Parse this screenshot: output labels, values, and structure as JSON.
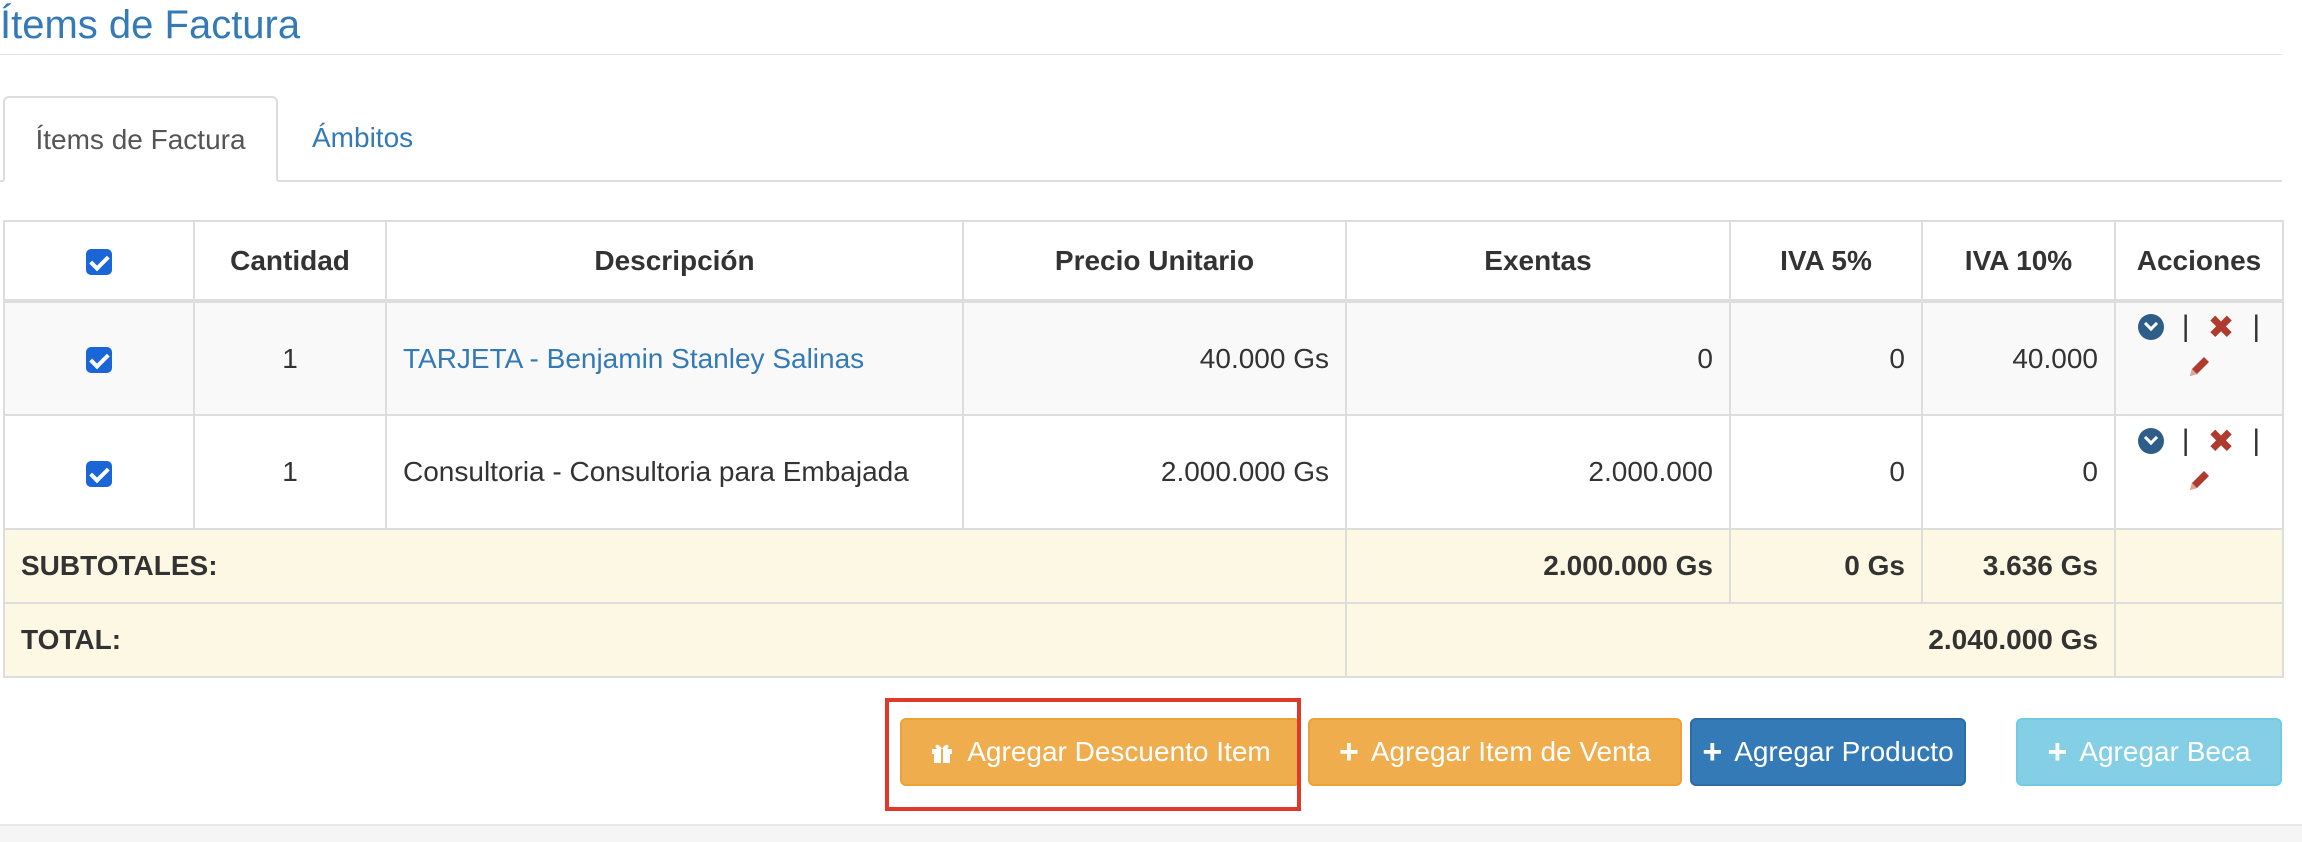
{
  "page_title": "Ítems de Factura",
  "tabs": [
    {
      "label": "Ítems de Factura",
      "active": true
    },
    {
      "label": "Ámbitos",
      "active": false
    }
  ],
  "table": {
    "headers": [
      "Cantidad",
      "Descripción",
      "Precio Unitario",
      "Exentas",
      "IVA 5%",
      "IVA 10%",
      "Acciones"
    ],
    "rows": [
      {
        "checked": true,
        "cantidad": "1",
        "descripcion": "TARJETA - Benjamin Stanley Salinas",
        "precio": "40.000 Gs",
        "exentas": "0",
        "iva5": "0",
        "iva10": "40.000"
      },
      {
        "checked": true,
        "cantidad": "1",
        "descripcion": "Consultoria - Consultoria para Embajada",
        "precio": "2.000.000 Gs",
        "exentas": "2.000.000",
        "iva5": "0",
        "iva10": "0"
      }
    ],
    "subtotales": {
      "label": "SUBTOTALES:",
      "exentas": "2.000.000 Gs",
      "iva5": "0 Gs",
      "iva10": "3.636 Gs"
    },
    "total": {
      "label": "TOTAL:",
      "value": "2.040.000 Gs"
    },
    "action_separator": "|"
  },
  "buttons": {
    "descuento": "Agregar Descuento Item",
    "item_venta": "Agregar Item de Venta",
    "producto": "Agregar Producto",
    "beca": "Agregar Beca"
  },
  "colors": {
    "link": "#337ab7",
    "warning": "#f0ad4e",
    "primary": "#337ab7",
    "info": "#5bc0de",
    "subtotal_bg": "#fcf8e3",
    "highlight": "#e0392b"
  }
}
